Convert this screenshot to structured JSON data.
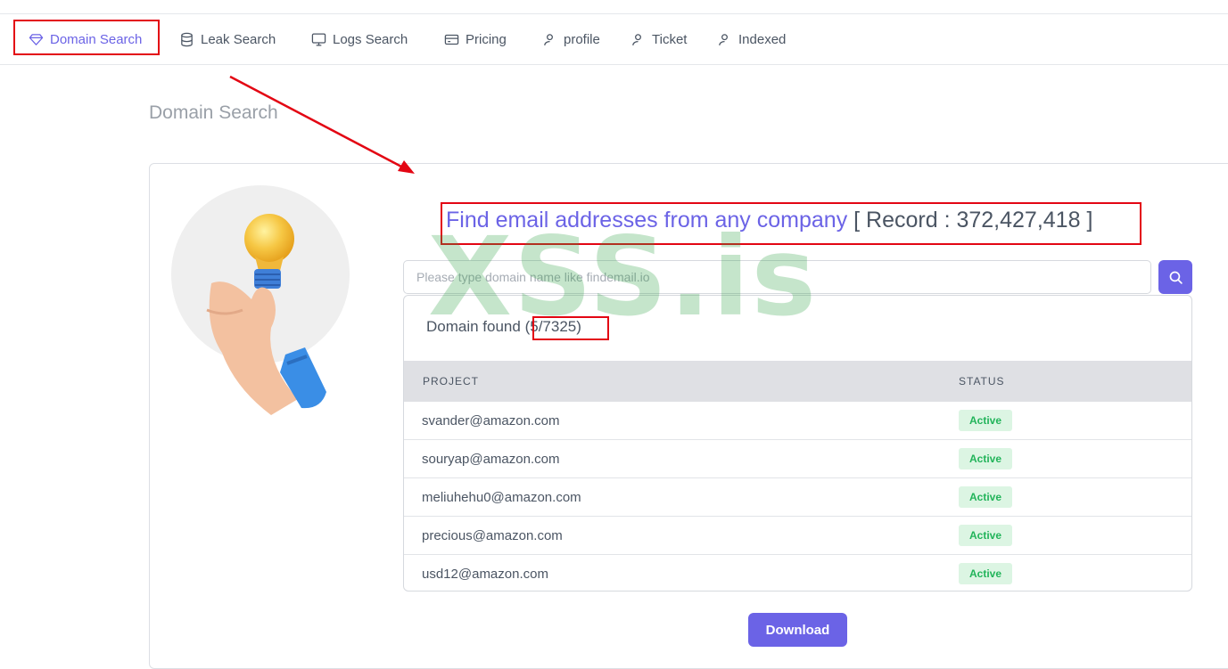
{
  "nav": {
    "items": [
      {
        "label": "Domain Search",
        "icon": "diamond-icon",
        "active": true
      },
      {
        "label": "Leak Search",
        "icon": "database-icon"
      },
      {
        "label": "Logs Search",
        "icon": "monitor-icon"
      },
      {
        "label": "Pricing",
        "icon": "card-icon"
      },
      {
        "label": "profile",
        "icon": "user-icon"
      },
      {
        "label": "Ticket",
        "icon": "user-icon"
      },
      {
        "label": "Indexed",
        "icon": "user-icon"
      }
    ]
  },
  "page": {
    "title": "Domain Search"
  },
  "headline": {
    "lead": "Find email addresses from any company",
    "record": " [ Record : 372,427,418 ]"
  },
  "search": {
    "placeholder": "Please type domain name like findemail.io",
    "value": "",
    "button_icon": "search-icon"
  },
  "results": {
    "found_label": "Domain found ",
    "found_count": "(5/7325)",
    "columns": [
      "PROJECT",
      "STATUS"
    ],
    "rows": [
      {
        "email": "svander@amazon.com",
        "status": "Active"
      },
      {
        "email": "souryap@amazon.com",
        "status": "Active"
      },
      {
        "email": "meliuhehu0@amazon.com",
        "status": "Active"
      },
      {
        "email": "precious@amazon.com",
        "status": "Active"
      },
      {
        "email": "usd12@amazon.com",
        "status": "Active"
      }
    ]
  },
  "download_label": "Download",
  "watermark": "XSS.is",
  "colors": {
    "accent": "#6b63e6",
    "highlight_box": "#e30613",
    "active_badge_bg": "#dcf5e3",
    "active_badge_text": "#22b45a"
  }
}
